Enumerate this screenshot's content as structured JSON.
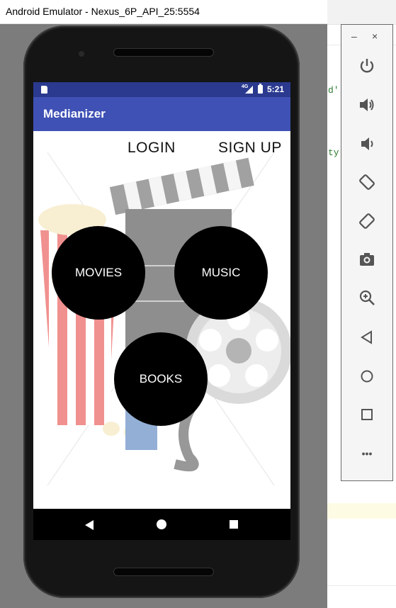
{
  "window": {
    "title": "Android Emulator - Nexus_6P_API_25:5554"
  },
  "ide": {
    "snippet1": "d'",
    "snippet2": "ty"
  },
  "status_bar": {
    "network": "4G",
    "time": "5:21"
  },
  "app_bar": {
    "title": "Medianizer"
  },
  "top_links": {
    "login": "LOGIN",
    "signup": "SIGN UP"
  },
  "buttons": {
    "movies": "MOVIES",
    "music": "MUSIC",
    "books": "BOOKS"
  },
  "toolbar": {
    "minimize": "–",
    "close": "×",
    "more": "•••",
    "icons": [
      "power-icon",
      "volume-up-icon",
      "volume-down-icon",
      "rotate-left-icon",
      "rotate-right-icon",
      "camera-icon",
      "zoom-icon",
      "back-icon",
      "home-icon",
      "overview-icon",
      "more-icon"
    ]
  },
  "colors": {
    "status_bar": "#2b3a8f",
    "app_bar": "#3f51b5",
    "button_fill": "#000000",
    "emulator_frame": "#7c7c7c"
  }
}
